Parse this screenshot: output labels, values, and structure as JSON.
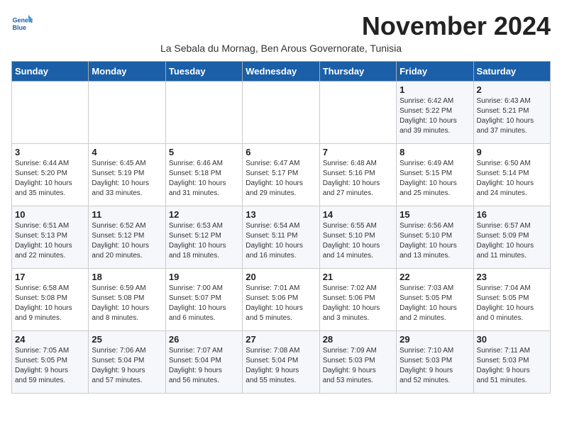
{
  "logo": {
    "line1": "General",
    "line2": "Blue"
  },
  "title": "November 2024",
  "subtitle": "La Sebala du Mornag, Ben Arous Governorate, Tunisia",
  "days_of_week": [
    "Sunday",
    "Monday",
    "Tuesday",
    "Wednesday",
    "Thursday",
    "Friday",
    "Saturday"
  ],
  "weeks": [
    [
      {
        "day": "",
        "info": ""
      },
      {
        "day": "",
        "info": ""
      },
      {
        "day": "",
        "info": ""
      },
      {
        "day": "",
        "info": ""
      },
      {
        "day": "",
        "info": ""
      },
      {
        "day": "1",
        "info": "Sunrise: 6:42 AM\nSunset: 5:22 PM\nDaylight: 10 hours\nand 39 minutes."
      },
      {
        "day": "2",
        "info": "Sunrise: 6:43 AM\nSunset: 5:21 PM\nDaylight: 10 hours\nand 37 minutes."
      }
    ],
    [
      {
        "day": "3",
        "info": "Sunrise: 6:44 AM\nSunset: 5:20 PM\nDaylight: 10 hours\nand 35 minutes."
      },
      {
        "day": "4",
        "info": "Sunrise: 6:45 AM\nSunset: 5:19 PM\nDaylight: 10 hours\nand 33 minutes."
      },
      {
        "day": "5",
        "info": "Sunrise: 6:46 AM\nSunset: 5:18 PM\nDaylight: 10 hours\nand 31 minutes."
      },
      {
        "day": "6",
        "info": "Sunrise: 6:47 AM\nSunset: 5:17 PM\nDaylight: 10 hours\nand 29 minutes."
      },
      {
        "day": "7",
        "info": "Sunrise: 6:48 AM\nSunset: 5:16 PM\nDaylight: 10 hours\nand 27 minutes."
      },
      {
        "day": "8",
        "info": "Sunrise: 6:49 AM\nSunset: 5:15 PM\nDaylight: 10 hours\nand 25 minutes."
      },
      {
        "day": "9",
        "info": "Sunrise: 6:50 AM\nSunset: 5:14 PM\nDaylight: 10 hours\nand 24 minutes."
      }
    ],
    [
      {
        "day": "10",
        "info": "Sunrise: 6:51 AM\nSunset: 5:13 PM\nDaylight: 10 hours\nand 22 minutes."
      },
      {
        "day": "11",
        "info": "Sunrise: 6:52 AM\nSunset: 5:12 PM\nDaylight: 10 hours\nand 20 minutes."
      },
      {
        "day": "12",
        "info": "Sunrise: 6:53 AM\nSunset: 5:12 PM\nDaylight: 10 hours\nand 18 minutes."
      },
      {
        "day": "13",
        "info": "Sunrise: 6:54 AM\nSunset: 5:11 PM\nDaylight: 10 hours\nand 16 minutes."
      },
      {
        "day": "14",
        "info": "Sunrise: 6:55 AM\nSunset: 5:10 PM\nDaylight: 10 hours\nand 14 minutes."
      },
      {
        "day": "15",
        "info": "Sunrise: 6:56 AM\nSunset: 5:10 PM\nDaylight: 10 hours\nand 13 minutes."
      },
      {
        "day": "16",
        "info": "Sunrise: 6:57 AM\nSunset: 5:09 PM\nDaylight: 10 hours\nand 11 minutes."
      }
    ],
    [
      {
        "day": "17",
        "info": "Sunrise: 6:58 AM\nSunset: 5:08 PM\nDaylight: 10 hours\nand 9 minutes."
      },
      {
        "day": "18",
        "info": "Sunrise: 6:59 AM\nSunset: 5:08 PM\nDaylight: 10 hours\nand 8 minutes."
      },
      {
        "day": "19",
        "info": "Sunrise: 7:00 AM\nSunset: 5:07 PM\nDaylight: 10 hours\nand 6 minutes."
      },
      {
        "day": "20",
        "info": "Sunrise: 7:01 AM\nSunset: 5:06 PM\nDaylight: 10 hours\nand 5 minutes."
      },
      {
        "day": "21",
        "info": "Sunrise: 7:02 AM\nSunset: 5:06 PM\nDaylight: 10 hours\nand 3 minutes."
      },
      {
        "day": "22",
        "info": "Sunrise: 7:03 AM\nSunset: 5:05 PM\nDaylight: 10 hours\nand 2 minutes."
      },
      {
        "day": "23",
        "info": "Sunrise: 7:04 AM\nSunset: 5:05 PM\nDaylight: 10 hours\nand 0 minutes."
      }
    ],
    [
      {
        "day": "24",
        "info": "Sunrise: 7:05 AM\nSunset: 5:05 PM\nDaylight: 9 hours\nand 59 minutes."
      },
      {
        "day": "25",
        "info": "Sunrise: 7:06 AM\nSunset: 5:04 PM\nDaylight: 9 hours\nand 57 minutes."
      },
      {
        "day": "26",
        "info": "Sunrise: 7:07 AM\nSunset: 5:04 PM\nDaylight: 9 hours\nand 56 minutes."
      },
      {
        "day": "27",
        "info": "Sunrise: 7:08 AM\nSunset: 5:04 PM\nDaylight: 9 hours\nand 55 minutes."
      },
      {
        "day": "28",
        "info": "Sunrise: 7:09 AM\nSunset: 5:03 PM\nDaylight: 9 hours\nand 53 minutes."
      },
      {
        "day": "29",
        "info": "Sunrise: 7:10 AM\nSunset: 5:03 PM\nDaylight: 9 hours\nand 52 minutes."
      },
      {
        "day": "30",
        "info": "Sunrise: 7:11 AM\nSunset: 5:03 PM\nDaylight: 9 hours\nand 51 minutes."
      }
    ]
  ]
}
